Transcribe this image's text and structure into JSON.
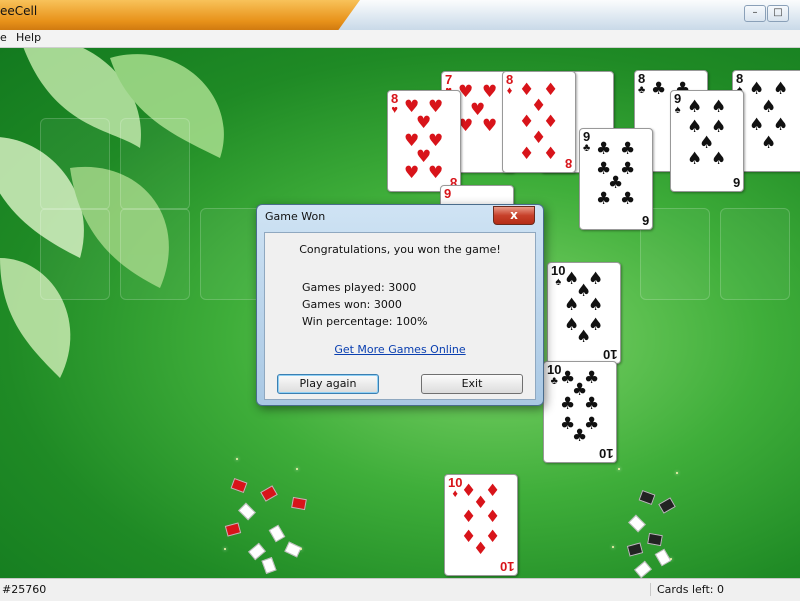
{
  "window": {
    "title": "eeCell",
    "minimize_glyph": "–",
    "maximize_glyph": "□",
    "close_glyph": "✕"
  },
  "menu": {
    "game_label": "e",
    "help_label": "Help"
  },
  "cards": {
    "heart_8": "8",
    "heart_7": "7",
    "diamond_8": "8",
    "heart_9": "9",
    "club_8": "8",
    "spade_9": "9",
    "club_9": "9",
    "spade_8": "8",
    "spade_10": "10",
    "club_10": "10",
    "diamond_10": "10",
    "heart_suit": "♥",
    "diamond_suit": "♦",
    "club_suit": "♣",
    "spade_suit": "♠",
    "spade_9_corner": "6",
    "club_9_corner": "6",
    "diamond_8_corner": "8",
    "heart_8_corner": "8",
    "spade_10_corner": "10",
    "club_10_corner": "10",
    "diamond_10_corner": "10"
  },
  "dialog": {
    "title": "Game Won",
    "close_glyph": "x",
    "congrats": "Congratulations, you won the game!",
    "games_played": "Games played: 3000",
    "games_won": "Games won: 3000",
    "win_percentage": "Win percentage: 100%",
    "more_games_link": "Get More Games Online",
    "play_again_label": "Play again",
    "exit_label": "Exit"
  },
  "status": {
    "game_number": "#25760",
    "cards_left": "Cards left: 0"
  },
  "colors": {
    "felt": "#2c8c2c",
    "red_suit": "#d8141a",
    "black_suit": "#111111",
    "link": "#0a3fb0"
  }
}
